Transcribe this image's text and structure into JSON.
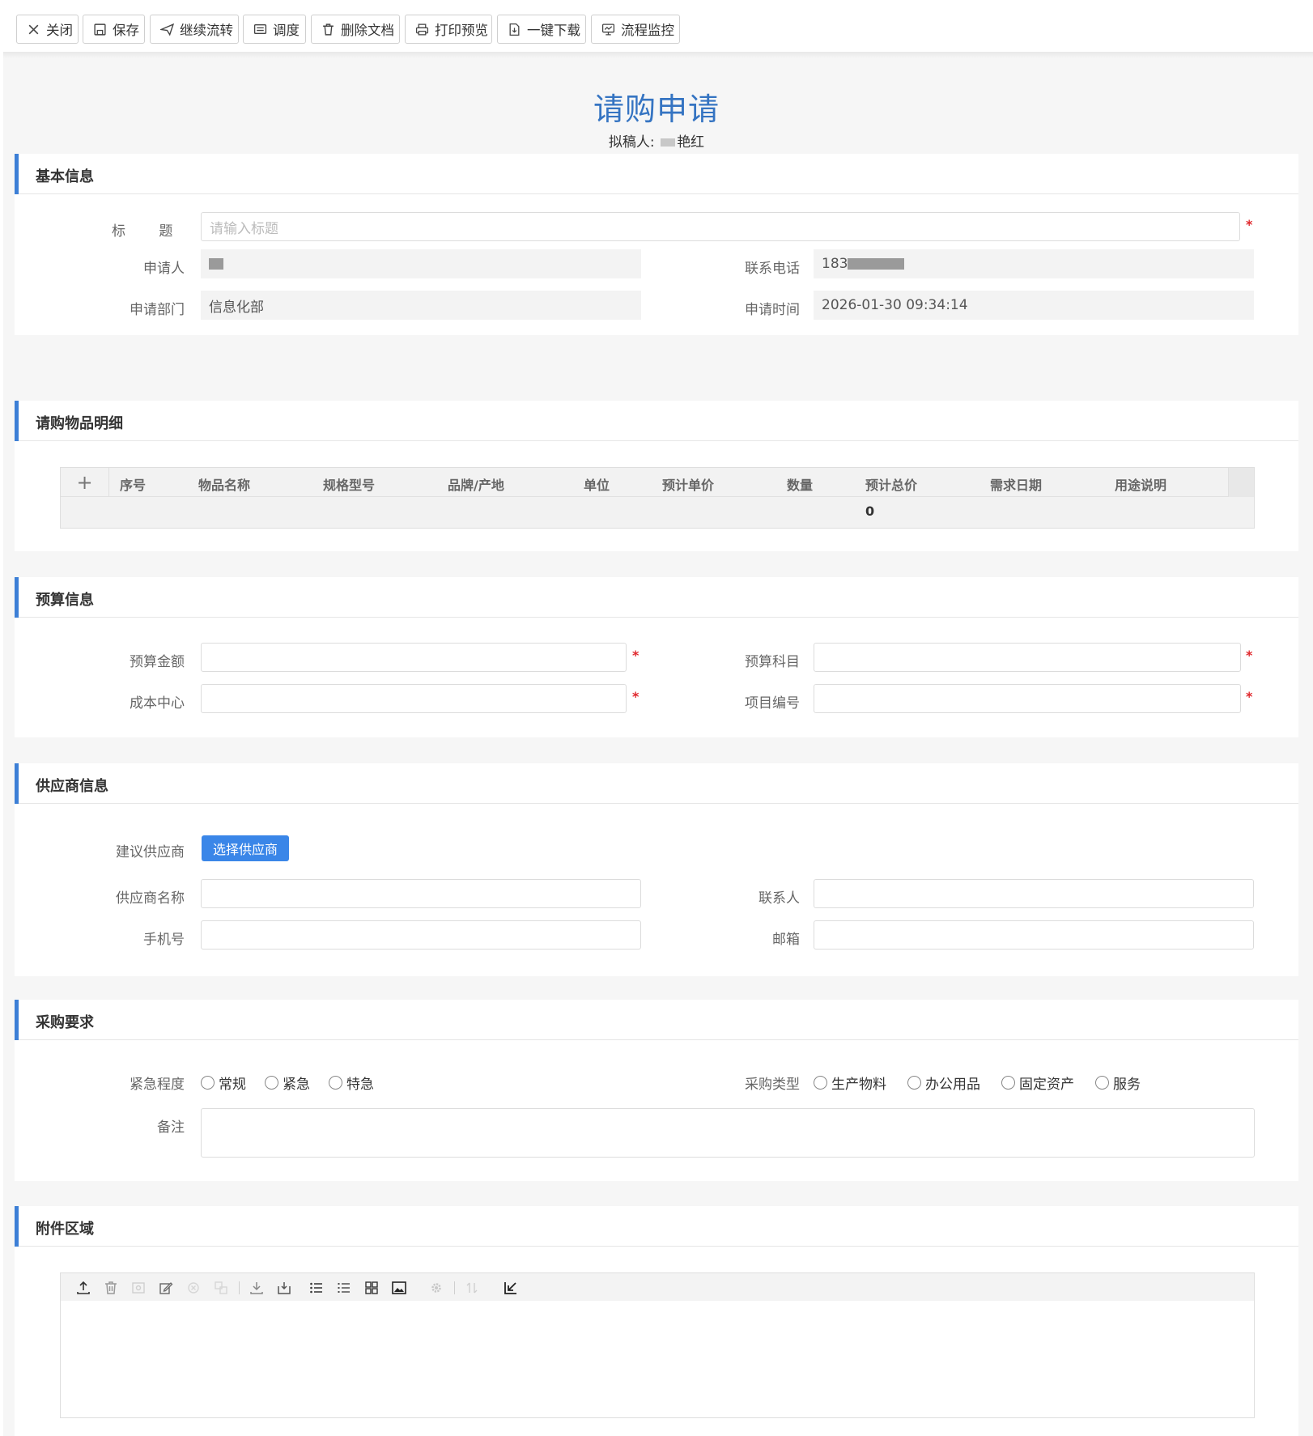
{
  "toolbar": {
    "close": "关闭",
    "save": "保存",
    "continue_flow": "继续流转",
    "dispatch": "调度",
    "delete_doc": "删除文档",
    "print_preview": "打印预览",
    "download": "一键下载",
    "flow_monitor": "流程监控"
  },
  "header": {
    "title": "请购申请",
    "drafter_label": "拟稿人:",
    "drafter_value": "艳红"
  },
  "basic": {
    "section_title": "基本信息",
    "title_label": "标 题",
    "title_placeholder": "请输入标题",
    "applicant_label": "申请人",
    "phone_label": "联系电话",
    "phone_value": "183",
    "dept_label": "申请部门",
    "dept_value": "信息化部",
    "time_label": "申请时间",
    "time_value": "2026-01-30 09:34:14"
  },
  "items": {
    "section_title": "请购物品明细",
    "add_symbol": "+",
    "columns": [
      "序号",
      "物品名称",
      "规格型号",
      "品牌/产地",
      "单位",
      "预计单价",
      "数量",
      "预计总价",
      "需求日期",
      "用途说明"
    ],
    "total": "0"
  },
  "budget": {
    "section_title": "预算信息",
    "amount_label": "预算金额",
    "subject_label": "预算科目",
    "cost_center_label": "成本中心",
    "project_no_label": "项目编号"
  },
  "supplier": {
    "section_title": "供应商信息",
    "suggest_label": "建议供应商",
    "select_button": "选择供应商",
    "name_label": "供应商名称",
    "contact_label": "联系人",
    "mobile_label": "手机号",
    "email_label": "邮箱"
  },
  "requirements": {
    "section_title": "采购要求",
    "urgency_label": "紧急程度",
    "urgency_options": [
      "常规",
      "紧急",
      "特急"
    ],
    "type_label": "采购类型",
    "type_options": [
      "生产物料",
      "办公用品",
      "固定资产",
      "服务"
    ],
    "remark_label": "备注"
  },
  "attachments": {
    "section_title": "附件区域"
  },
  "colors": {
    "accent": "#3c7fd6",
    "title": "#3574c2",
    "required": "#e0262b",
    "button": "#3a86e8"
  }
}
